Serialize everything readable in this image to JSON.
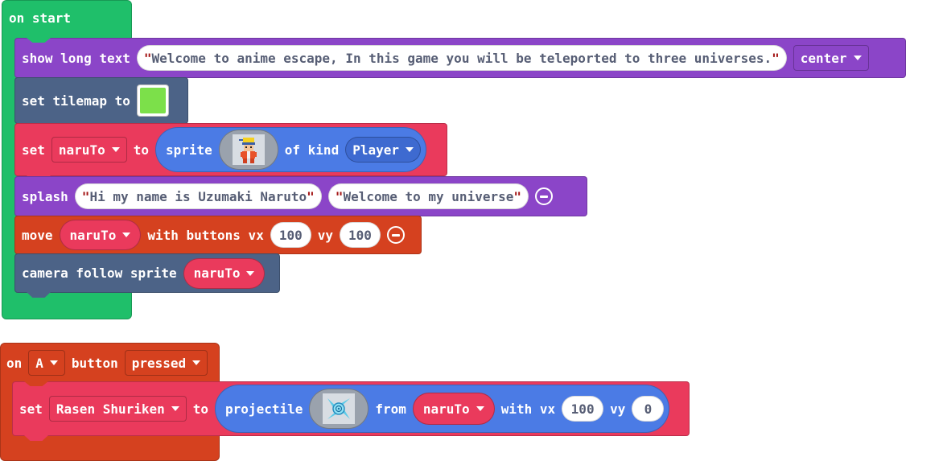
{
  "colors": {
    "events": "#1fbf6a",
    "looks": "#8b45c8",
    "scene": "#4c6387",
    "sprites": "#ea3a5c",
    "sprite_reporter": "#4b7be5",
    "controller": "#d5411f",
    "tilemap_swatch": "#7ce04a"
  },
  "on_start": {
    "hat_label": "on start",
    "show_long_text": {
      "label": "show long text",
      "text": "Welcome to anime escape, In this game you will be teleported to three universes.",
      "position": "center"
    },
    "set_tilemap": {
      "label": "set tilemap to"
    },
    "set_sprite": {
      "set_label": "set",
      "variable": "naruTo",
      "to_label": "to",
      "sprite_label": "sprite",
      "image_icon": "naruto-sprite-icon",
      "of_kind_label": "of kind",
      "kind": "Player"
    },
    "splash": {
      "label": "splash",
      "text1": "Hi my name is Uzumaki Naruto",
      "text2": " Welcome to my universe"
    },
    "move": {
      "label": "move",
      "sprite": "naruTo",
      "with_buttons_label": "with buttons vx",
      "vx": "100",
      "vy_label": "vy",
      "vy": "100"
    },
    "camera_follow": {
      "label": "camera follow sprite",
      "sprite": "naruTo"
    }
  },
  "on_a_pressed": {
    "on_label": "on",
    "button": "A",
    "button_label": "button",
    "event": "pressed",
    "set_projectile": {
      "set_label": "set",
      "variable": "Rasen Shuriken",
      "to_label": "to",
      "projectile_label": "projectile",
      "image_icon": "rasen-shuriken-icon",
      "from_label": "from",
      "from_sprite": "naruTo",
      "with_vx_label": "with vx",
      "vx": "100",
      "vy_label": "vy",
      "vy": "0"
    }
  }
}
